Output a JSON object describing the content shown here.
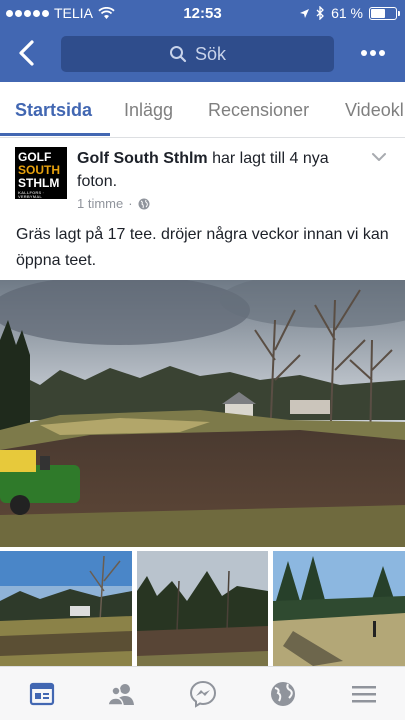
{
  "status_bar": {
    "carrier": "TELIA",
    "time": "12:53",
    "battery": "61 %",
    "battery_level": 0.61
  },
  "header": {
    "search_placeholder": "Sök"
  },
  "tabs": [
    {
      "label": "Startsida",
      "active": true
    },
    {
      "label": "Inlägg",
      "active": false
    },
    {
      "label": "Recensioner",
      "active": false
    },
    {
      "label": "Videokl",
      "active": false
    }
  ],
  "post": {
    "logo": {
      "line1": "GOLF",
      "line2": "SOUTH",
      "line3": "STHLM",
      "line4": "KALLFORS · VERBYMAL"
    },
    "author": "Golf South Sthlm",
    "action": " har lagt till 4 nya foton.",
    "time": "1 timme",
    "text": "Gräs lagt på 17 tee. dröjer några veckor innan vi kan öppna teet."
  },
  "nav": [
    "news-feed",
    "friends",
    "messenger",
    "notifications",
    "menu"
  ],
  "colors": {
    "brand": "#4267b2",
    "search_bg": "#2f4d8c",
    "muted": "#90949c",
    "text": "#1d2129",
    "logo_accent": "#e8a20e"
  }
}
